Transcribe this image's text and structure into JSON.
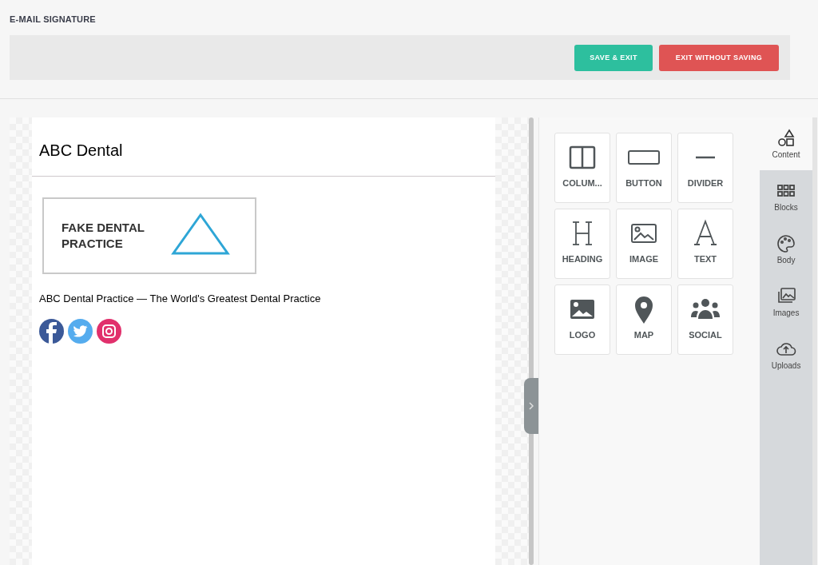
{
  "page": {
    "title": "E-MAIL SIGNATURE"
  },
  "toolbar": {
    "buttons": [
      {
        "label": "SAVE & EXIT",
        "kind": "save"
      },
      {
        "label": "EXIT WITHOUT SAVING",
        "kind": "cancel"
      }
    ]
  },
  "signature": {
    "name": "ABC Dental",
    "logo_text": "FAKE DENTAL PRACTICE",
    "tagline": "ABC Dental Practice — The World's Greatest Dental Practice",
    "social": [
      {
        "kind": "facebook",
        "color": "#3b5998"
      },
      {
        "kind": "twitter",
        "color": "#55acee"
      },
      {
        "kind": "instagram",
        "color": "#e1306c"
      }
    ]
  },
  "tools": [
    {
      "label": "COLUM...",
      "kind": "columns"
    },
    {
      "label": "BUTTON",
      "kind": "button"
    },
    {
      "label": "DIVIDER",
      "kind": "divider"
    },
    {
      "label": "HEADING",
      "kind": "heading"
    },
    {
      "label": "IMAGE",
      "kind": "image"
    },
    {
      "label": "TEXT",
      "kind": "text"
    },
    {
      "label": "LOGO",
      "kind": "logo"
    },
    {
      "label": "MAP",
      "kind": "map"
    },
    {
      "label": "SOCIAL",
      "kind": "social"
    }
  ],
  "tabs": [
    {
      "label": "Content",
      "kind": "content",
      "selected": true
    },
    {
      "label": "Blocks",
      "kind": "blocks",
      "selected": false
    },
    {
      "label": "Body",
      "kind": "body",
      "selected": false
    },
    {
      "label": "Images",
      "kind": "images",
      "selected": false
    },
    {
      "label": "Uploads",
      "kind": "uploads",
      "selected": false
    }
  ]
}
